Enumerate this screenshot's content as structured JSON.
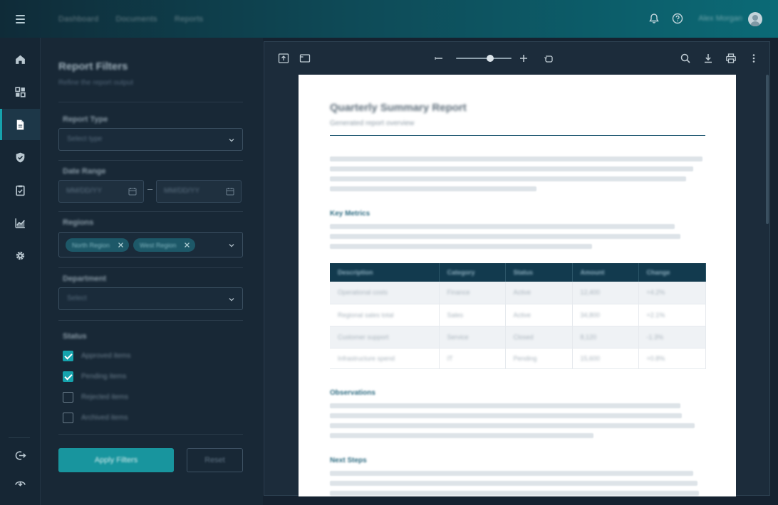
{
  "topbar": {
    "nav": [
      "Dashboard",
      "Documents",
      "Reports"
    ],
    "user_name": "Alex Morgan"
  },
  "rail": {
    "items": [
      "home",
      "dashboard",
      "documents",
      "security",
      "tasks",
      "analytics",
      "settings"
    ],
    "bottom": [
      "logout",
      "collapse"
    ],
    "active": "documents"
  },
  "filters": {
    "title": "Report Filters",
    "subtitle": "Refine the report output",
    "report_type": {
      "label": "Report Type",
      "value": "Select type"
    },
    "date_range": {
      "label": "Date Range",
      "from": "MM/DD/YY",
      "to": "MM/DD/YY"
    },
    "regions": {
      "label": "Regions",
      "chips": [
        "North Region",
        "West Region"
      ]
    },
    "department": {
      "label": "Department",
      "value": "Select"
    },
    "status": {
      "label": "Status",
      "options": [
        {
          "label": "Approved items",
          "checked": true
        },
        {
          "label": "Pending items",
          "checked": true
        },
        {
          "label": "Rejected items",
          "checked": false
        },
        {
          "label": "Archived items",
          "checked": false
        }
      ]
    },
    "apply_label": "Apply Filters",
    "reset_label": "Reset"
  },
  "viewer": {
    "zoom_fraction": 0.62
  },
  "document": {
    "title": "Quarterly Summary Report",
    "subtitle": "Generated report overview",
    "section1": "Key Metrics",
    "section2": "Observations",
    "section3": "Next Steps",
    "table": {
      "headers": [
        "Description",
        "Category",
        "Status",
        "Amount",
        "Change"
      ],
      "rows": [
        [
          "Operational costs",
          "Finance",
          "Active",
          "12,400",
          "+4.2%"
        ],
        [
          "Regional sales total",
          "Sales",
          "Active",
          "34,800",
          "+2.1%"
        ],
        [
          "Customer support",
          "Service",
          "Closed",
          "8,120",
          "-1.3%"
        ],
        [
          "Infrastructure spend",
          "IT",
          "Pending",
          "15,600",
          "+0.8%"
        ]
      ]
    }
  },
  "colors": {
    "accent": "#16a3ad",
    "table_header": "#123a4e"
  }
}
